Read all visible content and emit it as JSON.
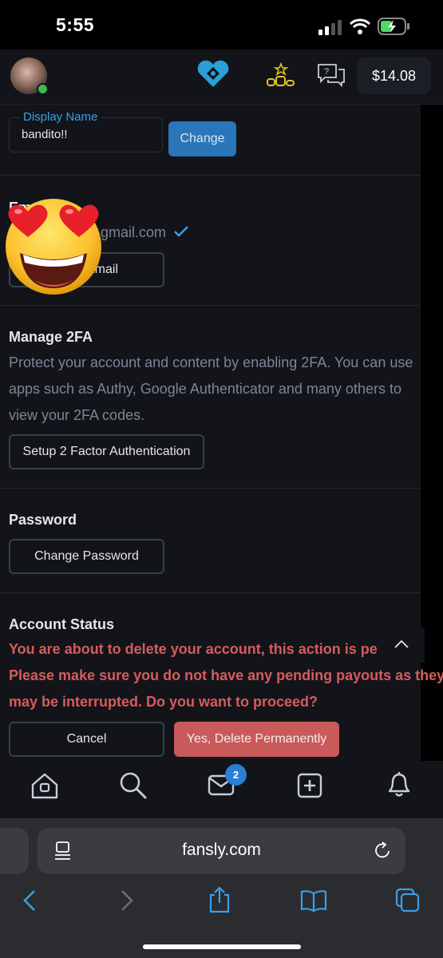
{
  "status_bar": {
    "time": "5:55"
  },
  "header": {
    "balance": "$14.08"
  },
  "display_name": {
    "label": "Display Name",
    "value": "bandito!!",
    "change_label": "Change"
  },
  "email": {
    "heading_partial": "Em",
    "address_partial": "gmail.com",
    "button_partial": "Email"
  },
  "twofa": {
    "heading": "Manage 2FA",
    "description_lines": [
      "Protect your account and content by enabling 2FA. You can use",
      "apps such as Authy, Google Authenticator and many others to",
      "view your 2FA codes."
    ],
    "button": "Setup 2 Factor Authentication"
  },
  "password": {
    "heading": "Password",
    "button": "Change Password"
  },
  "account_status": {
    "heading": "Account Status",
    "warning_lines": [
      "You are about to delete your account, this action is perma",
      "Please make sure you do not have any pending payouts as they",
      "may be interrupted. Do you want to proceed?"
    ],
    "cancel": "Cancel",
    "confirm": "Yes, Delete Permanently"
  },
  "bottom_nav": {
    "messages_badge": "2"
  },
  "safari": {
    "url": "fansly.com"
  },
  "colors": {
    "accent_blue": "#2a76b8",
    "danger_red": "#c85a5a",
    "warning_text": "#d65c5c",
    "label_blue": "#3a9fe8",
    "gold_icon": "#e8c31c"
  },
  "icons": [
    "signal-icon",
    "wifi-icon",
    "battery-charging-icon",
    "fansly-logo-icon",
    "leaderboard-icon",
    "help-chat-icon",
    "verified-check-icon",
    "chevron-up-icon",
    "home-icon",
    "search-icon",
    "mail-icon",
    "add-post-icon",
    "bell-icon",
    "reader-icon",
    "reload-icon",
    "back-icon",
    "forward-icon",
    "share-icon",
    "bookmarks-icon",
    "tabs-icon",
    "heart-eyes-emoji"
  ]
}
